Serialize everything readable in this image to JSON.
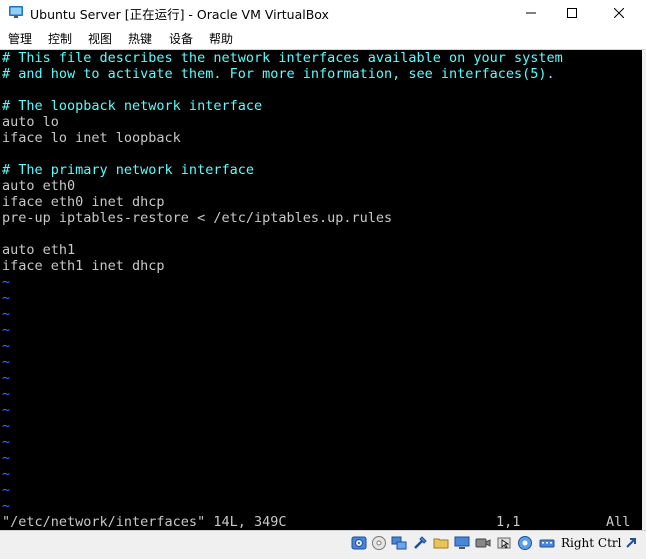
{
  "window": {
    "title": "Ubuntu Server [正在运行] - Oracle VM VirtualBox"
  },
  "menu": [
    "管理",
    "控制",
    "视图",
    "热键",
    "设备",
    "帮助"
  ],
  "editor": {
    "lines": [
      {
        "text": "# This file describes the network interfaces available on your system",
        "kind": "comment"
      },
      {
        "text": "# and how to activate them. For more information, see interfaces(5).",
        "kind": "comment"
      },
      {
        "text": "",
        "kind": "text"
      },
      {
        "text": "# The loopback network interface",
        "kind": "comment"
      },
      {
        "text": "auto lo",
        "kind": "text"
      },
      {
        "text": "iface lo inet loopback",
        "kind": "text"
      },
      {
        "text": "",
        "kind": "text"
      },
      {
        "text": "# The primary network interface",
        "kind": "comment"
      },
      {
        "text": "auto eth0",
        "kind": "text"
      },
      {
        "text": "iface eth0 inet dhcp",
        "kind": "text"
      },
      {
        "text": "pre-up iptables-restore < /etc/iptables.up.rules",
        "kind": "text"
      },
      {
        "text": "",
        "kind": "text"
      },
      {
        "text": "auto eth1",
        "kind": "text"
      },
      {
        "text": "iface eth1 inet dhcp",
        "kind": "text"
      },
      {
        "text": "~",
        "kind": "tilde"
      },
      {
        "text": "~",
        "kind": "tilde"
      },
      {
        "text": "~",
        "kind": "tilde"
      },
      {
        "text": "~",
        "kind": "tilde"
      },
      {
        "text": "~",
        "kind": "tilde"
      },
      {
        "text": "~",
        "kind": "tilde"
      },
      {
        "text": "~",
        "kind": "tilde"
      },
      {
        "text": "~",
        "kind": "tilde"
      },
      {
        "text": "~",
        "kind": "tilde"
      },
      {
        "text": "~",
        "kind": "tilde"
      },
      {
        "text": "~",
        "kind": "tilde"
      },
      {
        "text": "~",
        "kind": "tilde"
      },
      {
        "text": "~",
        "kind": "tilde"
      },
      {
        "text": "~",
        "kind": "tilde"
      },
      {
        "text": "~",
        "kind": "tilde"
      }
    ],
    "status": {
      "file": "\"/etc/network/interfaces\" 14L, 349C",
      "position": "1,1",
      "scroll": "All"
    }
  },
  "statusbar": {
    "icons": [
      "hard-disk-icon",
      "optical-drive-icon",
      "network-icon",
      "usb-icon",
      "shared-folders-icon",
      "display-icon",
      "video-capture-icon",
      "mouse-integration-icon",
      "cpu-icon",
      "keyboard-icon",
      "host-key-arrow-icon"
    ],
    "host_key": "Right Ctrl"
  },
  "colors": {
    "comment": "#55ffff",
    "text": "#c8c8c8",
    "tilde": "#3b6cff",
    "background": "#000000"
  }
}
